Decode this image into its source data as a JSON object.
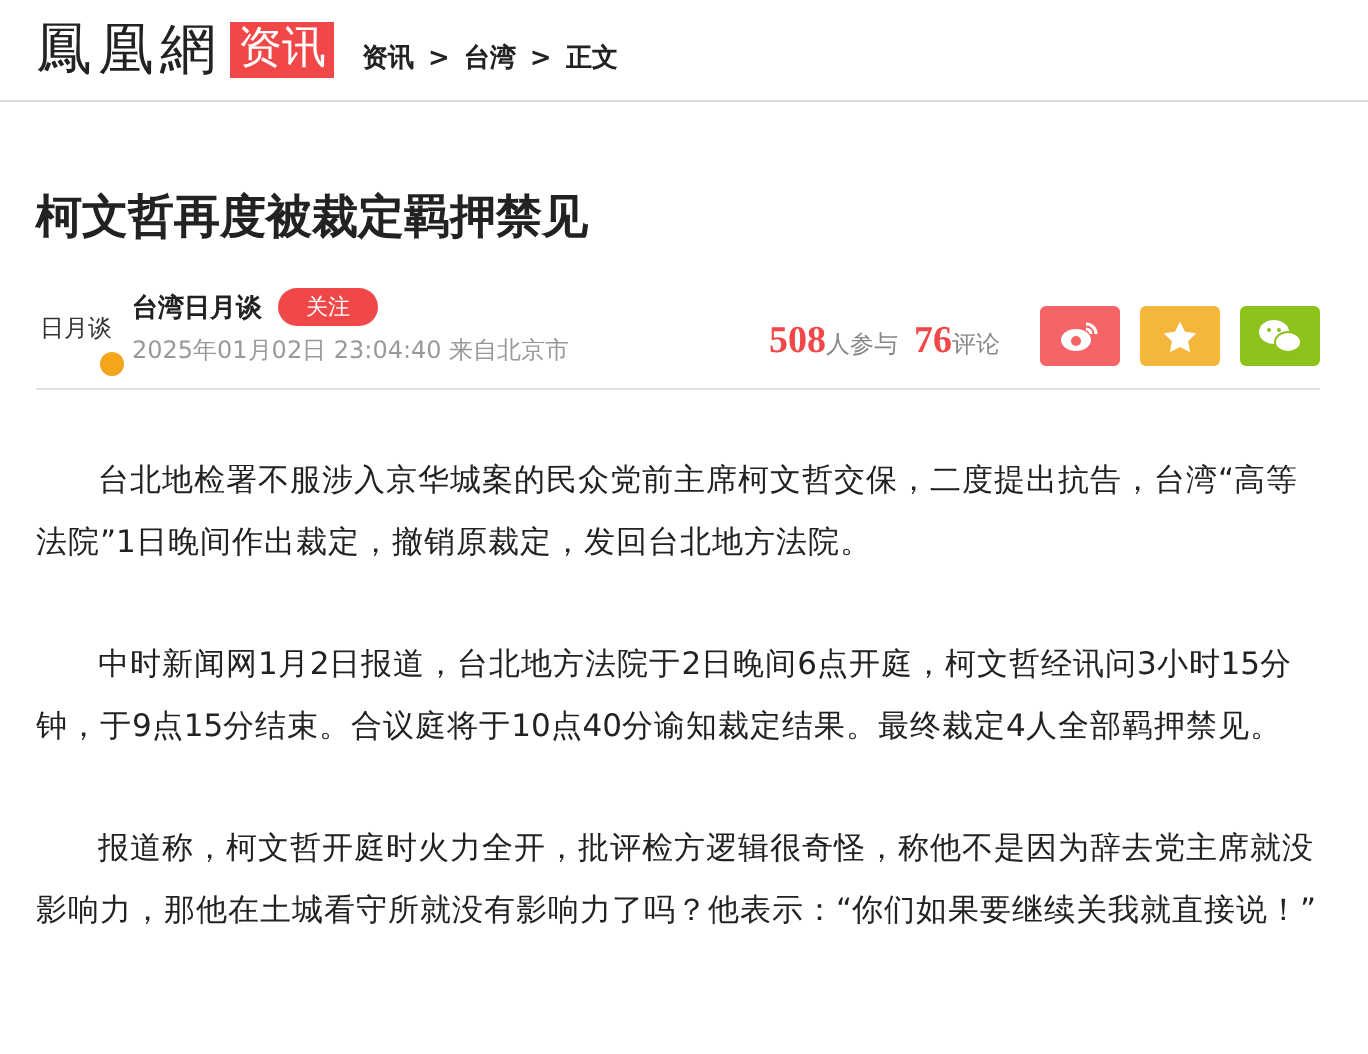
{
  "header": {
    "site_name": "鳳凰網",
    "channel_badge": "资讯",
    "breadcrumb": [
      {
        "label": "资讯"
      },
      {
        "label": "台湾"
      },
      {
        "label": "正文"
      }
    ],
    "separator": ">"
  },
  "article": {
    "title": "柯文哲再度被裁定羁押禁见",
    "author": {
      "avatar_text": "日月谈",
      "verified": true,
      "name": "台湾日月谈",
      "follow_label": "关注",
      "meta": "2025年01月02日 23:04:40 来自北京市"
    },
    "stats": [
      {
        "count": "508",
        "label": "人参与"
      },
      {
        "count": "76",
        "label": "评论"
      }
    ],
    "share_buttons": [
      {
        "kind": "weibo",
        "color": "#f56467"
      },
      {
        "kind": "favorite",
        "color": "#f4b73c"
      },
      {
        "kind": "wechat",
        "color": "#8cc21b"
      }
    ],
    "paragraphs": [
      "台北地检署不服涉入京华城案的民众党前主席柯文哲交保，二度提出抗告，台湾“高等法院”1日晚间作出裁定，撤销原裁定，发回台北地方法院。",
      "中时新闻网1月2日报道，台北地方法院于2日晚间6点开庭，柯文哲经讯问3小时15分钟，于9点15分结束。合议庭将于10点40分谕知裁定结果。最终裁定4人全部羁押禁见。",
      "报道称，柯文哲开庭时火力全开，批评检方逻辑很奇怪，称他不是因为辞去党主席就没影响力，那他在土城看守所就没有影响力了吗？他表示：“你们如果要继续关我就直接说！”"
    ]
  }
}
